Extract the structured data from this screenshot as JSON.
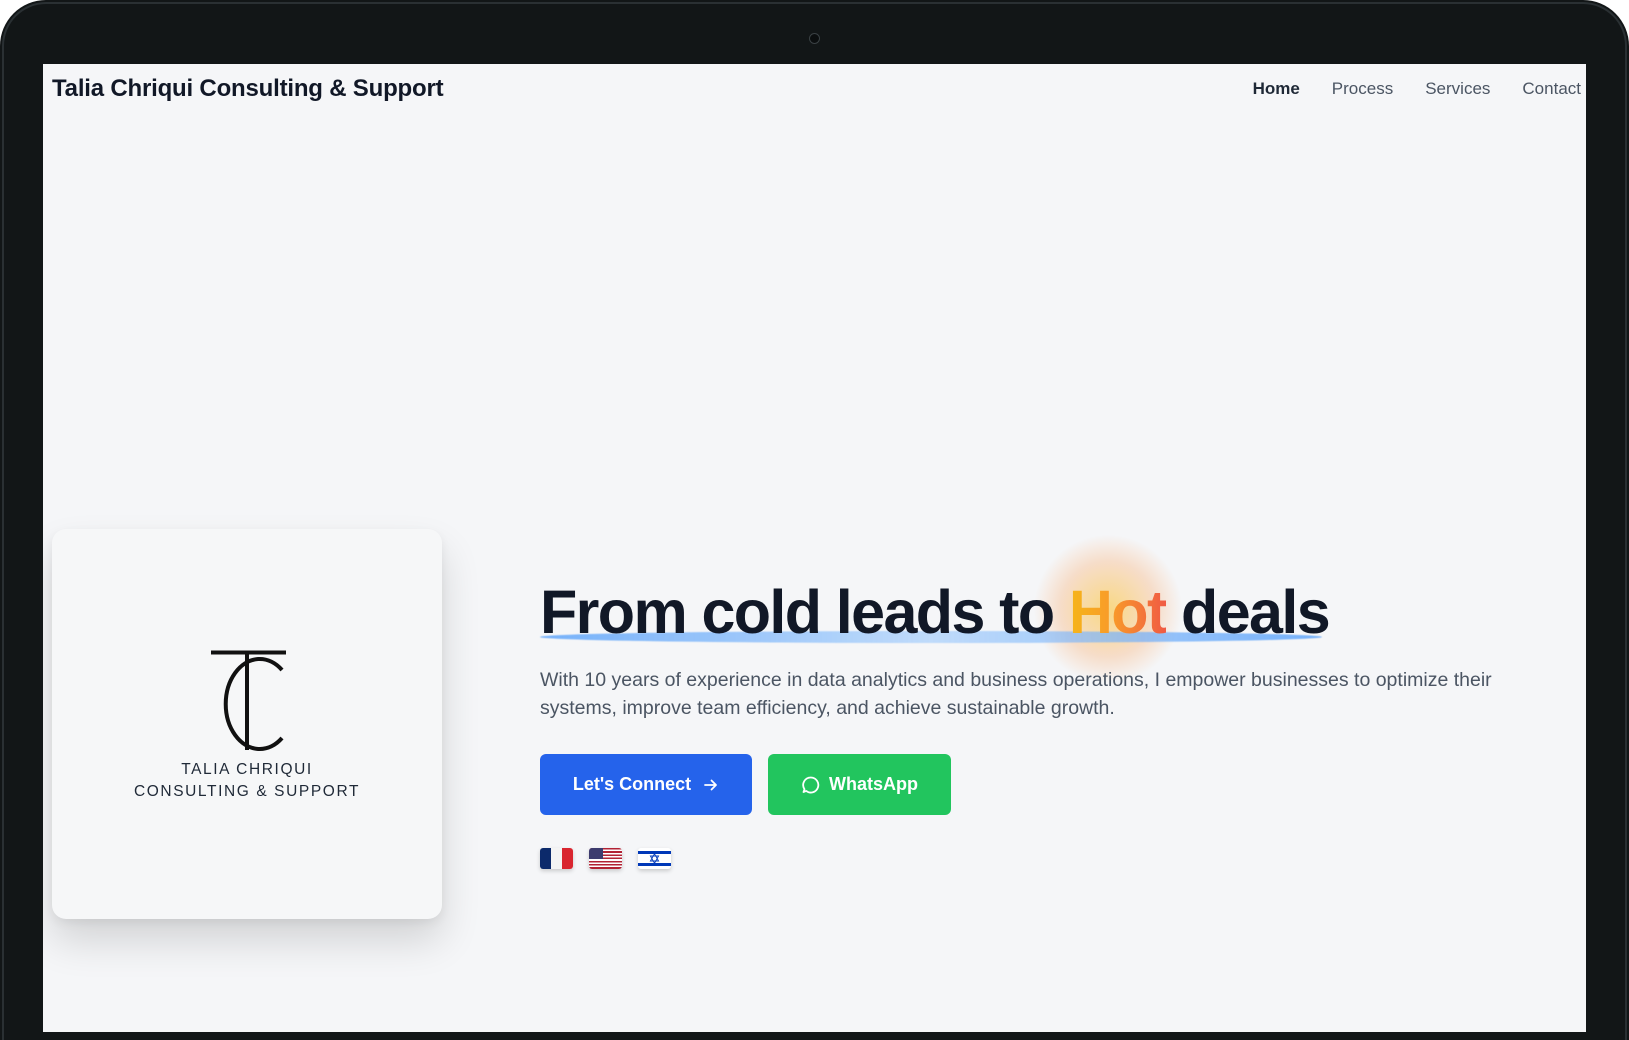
{
  "nav": {
    "brand": "Talia Chriqui Consulting & Support",
    "links": [
      {
        "label": "Home",
        "active": true
      },
      {
        "label": "Process",
        "active": false
      },
      {
        "label": "Services",
        "active": false
      },
      {
        "label": "Contact",
        "active": false
      }
    ]
  },
  "logo": {
    "line1": "TALIA CHRIQUI",
    "line2": "CONSULTING & SUPPORT"
  },
  "hero": {
    "title_before": "From cold leads to ",
    "title_highlight": "Hot",
    "title_after": " deals",
    "description": "With 10 years of experience in data analytics and business operations, I empower businesses to optimize their systems, improve team efficiency, and achieve sustainable growth.",
    "connect_label": "Let's Connect",
    "whatsapp_label": "WhatsApp"
  },
  "flags": [
    "fr",
    "us",
    "il"
  ],
  "icons": {
    "connect": "arrow-right-icon",
    "whatsapp": "whatsapp-icon"
  },
  "colors": {
    "primary": "#2563eb",
    "whatsapp": "#22c55e",
    "hot_start": "#f6b619",
    "hot_end": "#f05a44",
    "underline": "#60a5fa"
  }
}
